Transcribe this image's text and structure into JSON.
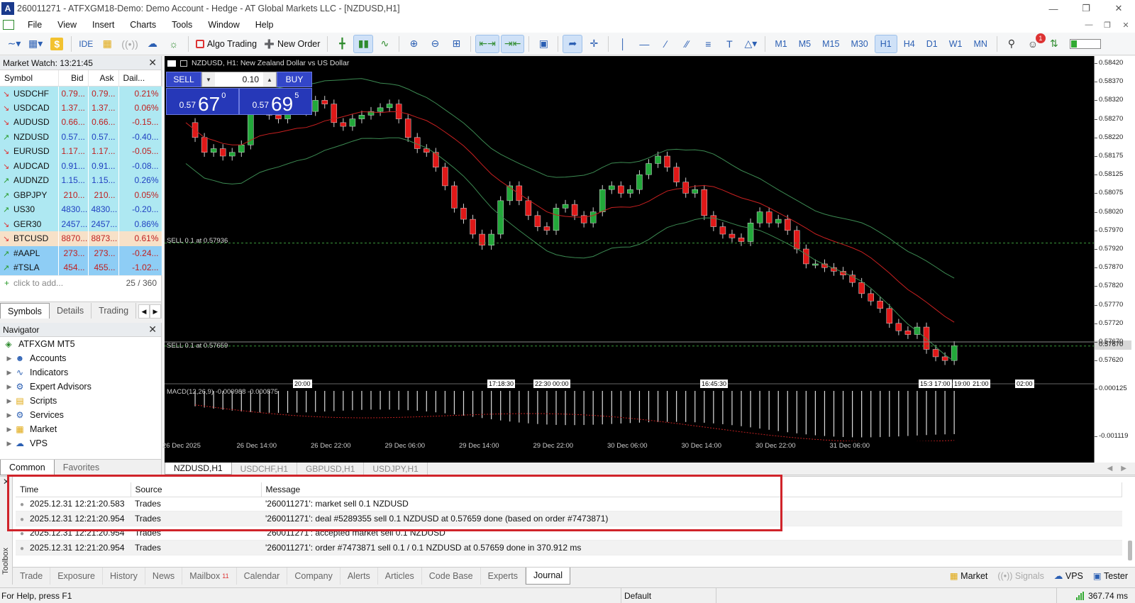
{
  "window": {
    "title": "260011271 - ATFXGM18-Demo: Demo Account - Hedge - AT Global Markets LLC - [NZDUSD,H1]",
    "logo_text": "A"
  },
  "menu": [
    "File",
    "View",
    "Insert",
    "Charts",
    "Tools",
    "Window",
    "Help"
  ],
  "toolbar": {
    "ide_label": "IDE",
    "algo_trading_label": "Algo Trading",
    "new_order_label": "New Order",
    "timeframes": [
      "M1",
      "M5",
      "M15",
      "M30",
      "H1",
      "H4",
      "D1",
      "W1",
      "MN"
    ],
    "active_timeframe": "H1",
    "notification_count": "1",
    "battery_level": 0.2
  },
  "market_watch": {
    "title": "Market Watch: 13:21:45",
    "columns": [
      "Symbol",
      "Bid",
      "Ask",
      "Dail..."
    ],
    "rows": [
      {
        "symbol": "USDCHF",
        "bid": "0.79...",
        "ask": "0.79...",
        "daily": "0.21%",
        "dir": "down",
        "bg": "#aee8f2",
        "color": "#c02020"
      },
      {
        "symbol": "USDCAD",
        "bid": "1.37...",
        "ask": "1.37...",
        "daily": "0.06%",
        "dir": "down",
        "bg": "#aee8f2",
        "color": "#c02020"
      },
      {
        "symbol": "AUDUSD",
        "bid": "0.66...",
        "ask": "0.66...",
        "daily": "-0.15...",
        "dir": "down",
        "bg": "#aee8f2",
        "color": "#c02020"
      },
      {
        "symbol": "NZDUSD",
        "bid": "0.57...",
        "ask": "0.57...",
        "daily": "-0.40...",
        "dir": "up",
        "bg": "#aee8f2",
        "color": "#2040c0"
      },
      {
        "symbol": "EURUSD",
        "bid": "1.17...",
        "ask": "1.17...",
        "daily": "-0.05...",
        "dir": "down",
        "bg": "#aee8f2",
        "color": "#c02020"
      },
      {
        "symbol": "AUDCAD",
        "bid": "0.91...",
        "ask": "0.91...",
        "daily": "-0.08...",
        "dir": "down",
        "bg": "#aee8f2",
        "color": "#2040c0"
      },
      {
        "symbol": "AUDNZD",
        "bid": "1.15...",
        "ask": "1.15...",
        "daily": "0.26%",
        "dir": "up",
        "bg": "#aee8f2",
        "color": "#2040c0"
      },
      {
        "symbol": "GBPJPY",
        "bid": "210...",
        "ask": "210...",
        "daily": "0.05%",
        "dir": "up",
        "bg": "#aee8f2",
        "color": "#c02020"
      },
      {
        "symbol": "US30",
        "bid": "4830...",
        "ask": "4830...",
        "daily": "-0.20...",
        "dir": "up",
        "bg": "#aee8f2",
        "color": "#2040c0"
      },
      {
        "symbol": "GER30",
        "bid": "2457...",
        "ask": "2457...",
        "daily": "0.86%",
        "dir": "down",
        "bg": "#aee8f2",
        "color": "#2040c0"
      },
      {
        "symbol": "BTCUSD",
        "bid": "8870...",
        "ask": "8873...",
        "daily": "0.61%",
        "dir": "down",
        "bg": "#f7e1c8",
        "color": "#c02020"
      },
      {
        "symbol": "#AAPL",
        "bid": "273...",
        "ask": "273...",
        "daily": "-0.24...",
        "dir": "up",
        "bg": "#8ecdf5",
        "color": "#c02020"
      },
      {
        "symbol": "#TSLA",
        "bid": "454...",
        "ask": "455...",
        "daily": "-1.02...",
        "dir": "up",
        "bg": "#8ecdf5",
        "color": "#c02020"
      }
    ],
    "add_placeholder": "click to add...",
    "count": "25 / 360",
    "tabs": [
      "Symbols",
      "Details",
      "Trading"
    ]
  },
  "navigator": {
    "title": "Navigator",
    "root": "ATFXGM MT5",
    "items": [
      {
        "label": "Accounts",
        "icon": "accounts-icon"
      },
      {
        "label": "Indicators",
        "icon": "indicators-icon"
      },
      {
        "label": "Expert Advisors",
        "icon": "expert-advisors-icon"
      },
      {
        "label": "Scripts",
        "icon": "scripts-icon"
      },
      {
        "label": "Services",
        "icon": "services-icon"
      },
      {
        "label": "Market",
        "icon": "market-icon"
      },
      {
        "label": "VPS",
        "icon": "vps-icon"
      }
    ],
    "tabs": [
      "Common",
      "Favorites"
    ]
  },
  "chart": {
    "title": "NZDUSD, H1:  New Zealand Dollar vs US Dollar",
    "trade_panel": {
      "sell_label": "SELL",
      "buy_label": "BUY",
      "lot": "0.10",
      "sell_small": "0.57",
      "sell_big": "67",
      "sell_sup": "0",
      "buy_small": "0.57",
      "buy_big": "69",
      "buy_sup": "5"
    },
    "price_labels": [
      "0.58420",
      "0.58370",
      "0.58320",
      "0.58270",
      "0.58220",
      "0.58175",
      "0.58125",
      "0.58075",
      "0.58020",
      "0.57970",
      "0.57920",
      "0.57870",
      "0.57820",
      "0.57770",
      "0.57720",
      "0.57670",
      "0.57620"
    ],
    "current_price": "0.57670",
    "macd_labels": [
      "0.000125",
      "-0.001119"
    ],
    "macd_title": "MACD(12,26,9) -0.000988 -0.000875",
    "line_labels": {
      "sell_upper": "SELL 0.1 at 0.57936",
      "sell_lower": "SELL 0.1 at 0.57659"
    },
    "time_tags": [
      "20:00",
      "17:18:30",
      "22:30 00:00",
      "16:45:30",
      "15:3",
      "17:00",
      "19:00",
      "21:00",
      "02:00"
    ],
    "time_labels": [
      "26 Dec 2025",
      "26 Dec 14:00",
      "26 Dec 22:00",
      "29 Dec 06:00",
      "29 Dec 14:00",
      "29 Dec 22:00",
      "30 Dec 06:00",
      "30 Dec 14:00",
      "30 Dec 22:00",
      "31 Dec 06:00"
    ],
    "tabs": [
      "NZDUSD,H1",
      "USDCHF,H1",
      "GBPUSD,H1",
      "USDJPY,H1"
    ],
    "colors": {
      "bull": "#22a83a",
      "bear": "#e01818",
      "bands": "#3c8a52",
      "ma": "#c82020"
    }
  },
  "journal": {
    "columns": [
      "Time",
      "Source",
      "Message"
    ],
    "rows": [
      {
        "time": "2025.12.31 12:21:20.583",
        "source": "Trades",
        "message": "'260011271': market sell 0.1 NZDUSD"
      },
      {
        "time": "2025.12.31 12:21:20.954",
        "source": "Trades",
        "message": "'260011271': deal #5289355 sell 0.1 NZDUSD at 0.57659 done (based on order #7473871)"
      },
      {
        "time": "2025.12.31 12:21:20.954",
        "source": "Trades",
        "message": "'260011271': accepted market sell 0.1 NZDUSD"
      },
      {
        "time": "2025.12.31 12:21:20.954",
        "source": "Trades",
        "message": "'260011271': order #7473871 sell 0.1 / 0.1 NZDUSD at 0.57659 done in 370.912 ms"
      }
    ],
    "side_label": "Toolbox",
    "tabs": [
      "Trade",
      "Exposure",
      "History",
      "News",
      "Mailbox",
      "Calendar",
      "Company",
      "Alerts",
      "Articles",
      "Code Base",
      "Experts",
      "Journal"
    ],
    "mailbox_badge": "11",
    "active_tab": "Journal",
    "right_items": {
      "market": "Market",
      "signals": "Signals",
      "vps": "VPS",
      "tester": "Tester"
    }
  },
  "status": {
    "help": "For Help, press F1",
    "profile": "Default",
    "ping": "367.74 ms"
  }
}
